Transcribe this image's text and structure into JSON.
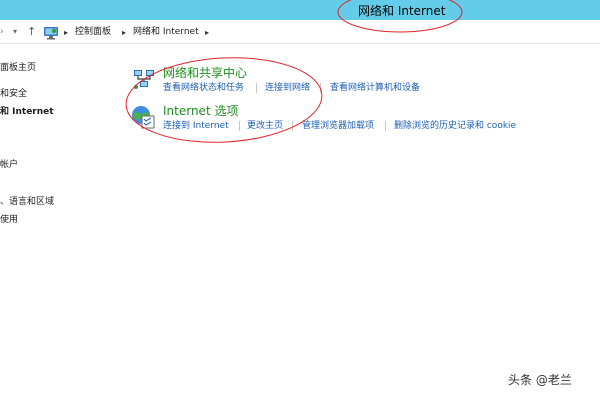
{
  "window": {
    "title": "网络和 Internet",
    "titlebar_color": "#63cde9",
    "annotation_color": "#e0242a"
  },
  "address_bar": {
    "back_icon": "chevron-right-icon",
    "recent_icon": "chevron-down-icon",
    "up_icon": "up-arrow-icon",
    "location_icon": "control-panel-icon",
    "crumbs": [
      "控制面板",
      "网络和 Internet"
    ]
  },
  "sidebar": {
    "items": [
      {
        "label": "面板主页",
        "current": false
      },
      {
        "label": "和安全",
        "current": false
      },
      {
        "label": "和 Internet",
        "current": true
      },
      {
        "label": "帐户",
        "current": false
      },
      {
        "label": "、语言和区域",
        "current": false
      },
      {
        "label": "使用",
        "current": false
      }
    ]
  },
  "categories": [
    {
      "title": "网络和共享中心",
      "icon": "network-sharing-center-icon",
      "tasks": [
        "查看网络状态和任务",
        "连接到网络",
        "查看网络计算机和设备"
      ]
    },
    {
      "title": "Internet 选项",
      "icon": "internet-options-icon",
      "tasks": [
        "连接到 Internet",
        "更改主页",
        "管理浏览器加载项",
        "删除浏览的历史记录和 cookie"
      ]
    }
  ],
  "colors": {
    "category_title": "#1e8c1e",
    "task_link": "#1c5fb5"
  },
  "watermark": "头条 @老兰"
}
